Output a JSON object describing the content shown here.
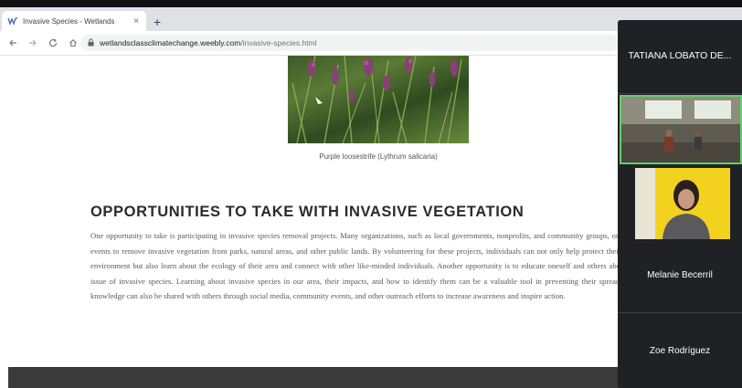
{
  "browser": {
    "tab_title": "Invasive Species - Wetlands",
    "tab_close": "×",
    "new_tab": "+",
    "url_host": "wetlandsclassclimatechange.weebly.com",
    "url_path": "/invasive-species.html"
  },
  "page": {
    "caption": "Purple loosestrife (Lythrum salicaria)",
    "section_title": "OPPORTUNITIES TO TAKE WITH INVASIVE VEGETATION",
    "paragraph": "One opportunity to take is participating in invasive species removal projects. Many organizations, such as local governments, nonprofits, and community groups, organize events to remove invasive vegetation from parks, natural areas, and other public lands. By volunteering for these projects, individuals can not only help protect their local environment but also learn about the ecology of their area and connect with other like-minded individuals. Another opportunity is to educate oneself and others about the issue of invasive species. Learning about invasive species in our area, their impacts, and how to identify them can be a valuable tool in preventing their spread. This knowledge can also be shared with others through social media, community events, and other outreach efforts to increase awareness and inspire action."
  },
  "call": {
    "participants": [
      {
        "name": "TATIANA LOBATO DE..."
      },
      {
        "name": ""
      },
      {
        "name": ""
      },
      {
        "name": "Melanie Becerril"
      },
      {
        "name": "Zoe Rodríguez"
      }
    ],
    "active_speaker_color": "#5fd16b"
  }
}
